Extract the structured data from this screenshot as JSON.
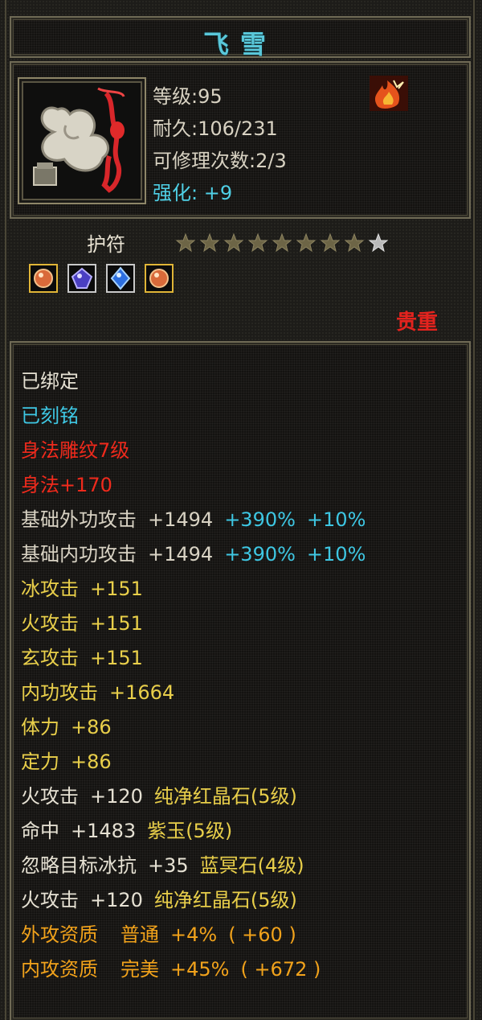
{
  "item": {
    "name": "飞雪",
    "level_label": "等级:",
    "level": "95",
    "durability_label": "耐久:",
    "durability": "106/231",
    "repair_label": "可修理次数:",
    "repair": "2/3",
    "enhance_label": "强化:",
    "enhance": "+9"
  },
  "amulet": {
    "label": "护符",
    "stars_filled": 8,
    "stars_total": 9,
    "rarity": "贵重"
  },
  "colors": {
    "title": "#59c7d9",
    "bound": "#e6e1d3",
    "engraved": "#3ec7e3",
    "red": "#ef2a1c",
    "yellow": "#e9cf4a",
    "orange": "#f1a21b"
  },
  "attributes": {
    "bound": "已绑定",
    "engraved": "已刻铭",
    "carve": "身法雕纹7级",
    "agility": "身法+170",
    "ext_atk_label": "基础外功攻击",
    "ext_atk_val": "+1494",
    "ext_atk_pct": "+390%",
    "ext_atk_pct2": "+10%",
    "int_atk_label": "基础内功攻击",
    "int_atk_val": "+1494",
    "int_atk_pct": "+390%",
    "int_atk_pct2": "+10%",
    "ice": "冰攻击",
    "ice_val": "+151",
    "fire": "火攻击",
    "fire_val": "+151",
    "mystic": "玄攻击",
    "mystic_val": "+151",
    "inner": "内功攻击",
    "inner_val": "+1664",
    "stamina": "体力",
    "stamina_val": "+86",
    "focus": "定力",
    "focus_val": "+86",
    "gem1_stat": "火攻击",
    "gem1_val": "+120",
    "gem1_name": "纯净红晶石",
    "gem1_lvl": "(5级)",
    "gem2_stat": "命中",
    "gem2_val": "+1483",
    "gem2_name": "紫玉",
    "gem2_lvl": "(5级)",
    "gem3_stat": "忽略目标冰抗",
    "gem3_val": "+35",
    "gem3_name": "蓝冥石",
    "gem3_lvl": "(4级)",
    "gem4_stat": "火攻击",
    "gem4_val": "+120",
    "gem4_name": "纯净红晶石",
    "gem4_lvl": "(5级)",
    "apt1_label": "外攻资质",
    "apt1_grade": "普通",
    "apt1_pct": "+4%",
    "apt1_val": "( +60 )",
    "apt2_label": "内攻资质",
    "apt2_grade": "完美",
    "apt2_pct": "+45%",
    "apt2_val": "( +672 )"
  }
}
